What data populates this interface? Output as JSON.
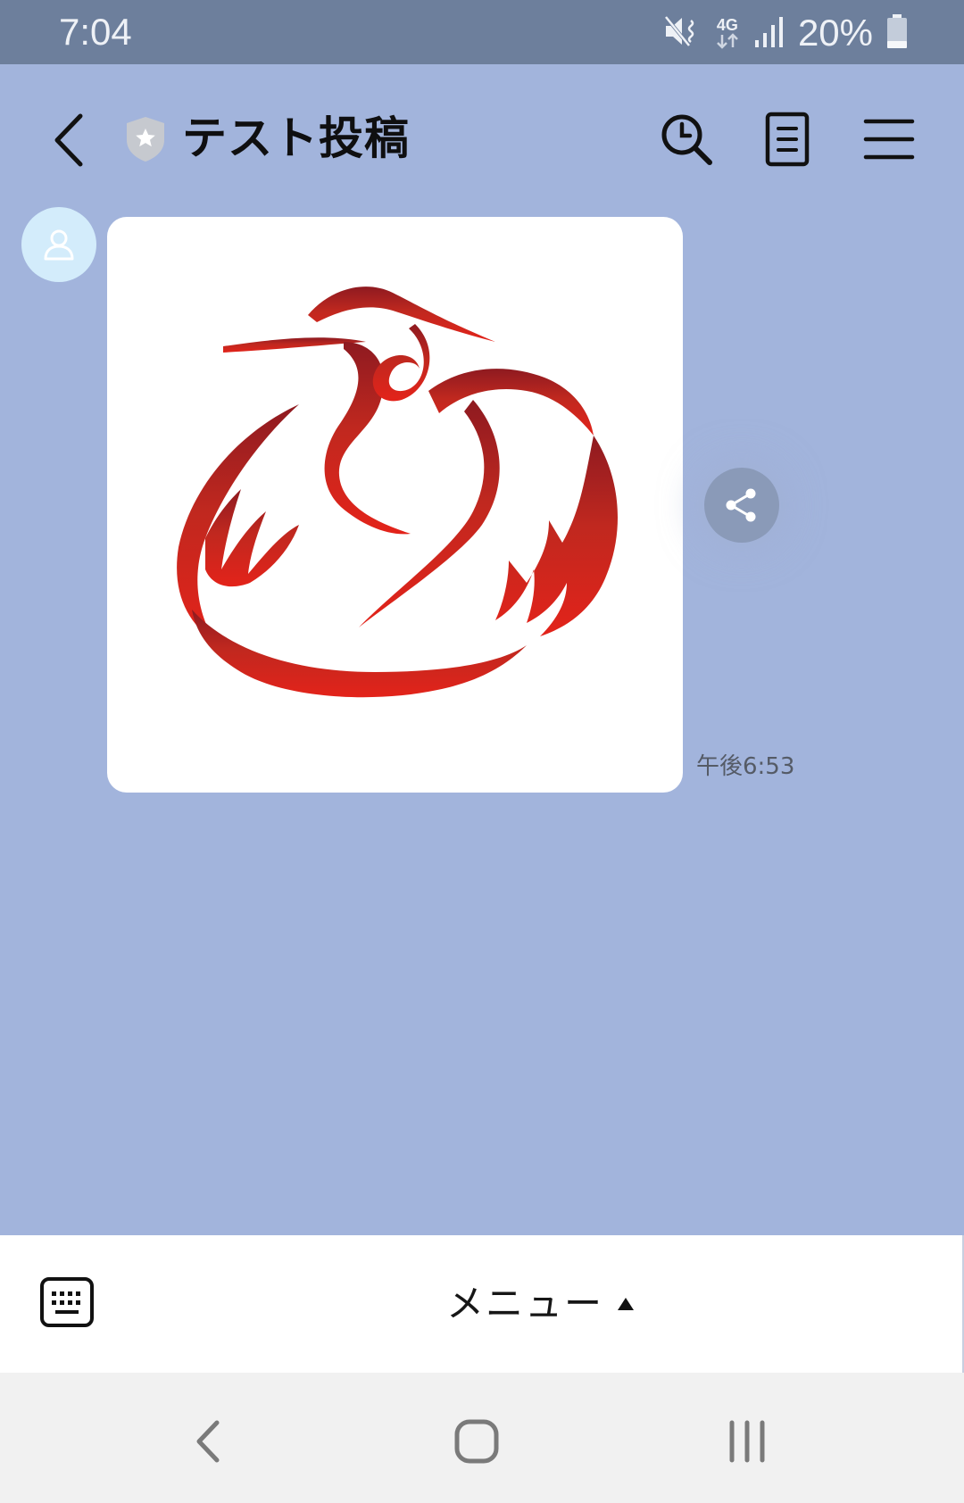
{
  "status_bar": {
    "time": "7:04",
    "network": "4G",
    "battery_percent": "20%",
    "icons": [
      "mute-vibrate-icon",
      "network-4g-icon",
      "signal-icon",
      "battery-icon"
    ]
  },
  "header": {
    "title": "テスト投稿",
    "badge_icon": "shield-star-icon",
    "actions": [
      "search-history-icon",
      "notes-icon",
      "menu-icon"
    ]
  },
  "message": {
    "image_description_icon": "crane-logo",
    "time": "午後6:53",
    "share_icon": "share-icon"
  },
  "menu_bar": {
    "label": "メニュー",
    "toggle_icon": "triangle-up-icon",
    "keyboard_icon": "keyboard-icon"
  },
  "nav_bar": {
    "icons": [
      "nav-back-icon",
      "nav-home-icon",
      "nav-recents-icon"
    ]
  },
  "colors": {
    "chat_background": "#a2b4dc",
    "status_bar": "#6d7f9c",
    "logo_red": "#d8251c"
  }
}
